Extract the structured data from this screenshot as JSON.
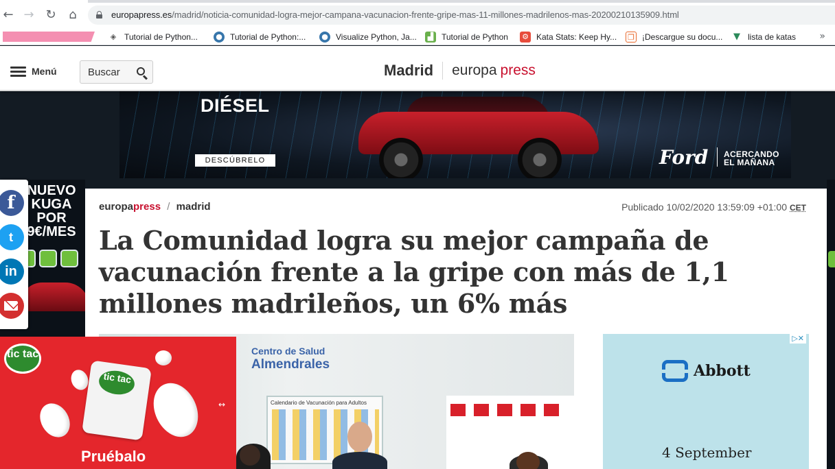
{
  "browser": {
    "nav": {
      "back": "←",
      "forward": "→",
      "reload": "↻",
      "home": "⌂"
    },
    "url": {
      "host": "europapress.es",
      "path": "/madrid/noticia-comunidad-logra-mejor-campana-vacunacion-frente-gripe-mas-11-millones-madrilenos-mas-20200210135909.html"
    },
    "bookmarks": [
      {
        "label": "Tutorial de Python...",
        "icon": "diamond-icon",
        "color": "#555555"
      },
      {
        "label": "Tutorial de Python:...",
        "icon": "python-icon",
        "color": "#3776ab"
      },
      {
        "label": "Visualize Python, Ja...",
        "icon": "python-icon",
        "color": "#3776ab"
      },
      {
        "label": "Tutorial de Python",
        "icon": "chart-icon",
        "color": "#6ab04c"
      },
      {
        "label": "Kata Stats: Keep Hy...",
        "icon": "kata-icon",
        "color": "#e74c3c"
      },
      {
        "label": "¡Descargue su docu...",
        "icon": "doc-icon",
        "color": "#e8672a"
      },
      {
        "label": "lista de katas",
        "icon": "vue-icon",
        "color": "#2c8a5a"
      }
    ],
    "more_bookmarks": "»"
  },
  "site_header": {
    "menu_label": "Menú",
    "search_placeholder": "Buscar",
    "section_name": "Madrid",
    "logo_part1": "europa",
    "logo_part2": "press"
  },
  "top_ad": {
    "headline": "DIÉSEL",
    "cta": "DESCÚBRELO",
    "brand": "Ford",
    "tagline_line1": "ACERCANDO",
    "tagline_line2": "EL MAÑANA"
  },
  "skin_ad": {
    "line1": "NUEVO",
    "line2": "KUGA",
    "line3": "POR",
    "line4": "9€/MES"
  },
  "share": {
    "facebook": "f",
    "twitter": "t",
    "linkedin": "in"
  },
  "article": {
    "breadcrumb_brand1": "europa",
    "breadcrumb_brand2": "press",
    "breadcrumb_sep": "/",
    "breadcrumb_section": "madrid",
    "published": "Publicado 10/02/2020 13:59:09 +01:00",
    "timezone": "CET",
    "headline": "La Comunidad logra su mejor campaña de vacunación frente a la gripe con más de 1,1 millones madrileños, un 6% más",
    "photo": {
      "sign_line1": "Centro de Salud",
      "sign_line2": "Almendrales",
      "board_title": "Calendario de Vacunación para Adultos"
    }
  },
  "sidebar_ad": {
    "adchoices": "▷✕",
    "brand": "Abbott",
    "date": "4 September"
  },
  "float_ad": {
    "logo": "tic tac",
    "pack_label": "tic tac",
    "cta": "Pruébalo",
    "arrows": "↔"
  },
  "colors": {
    "brand_red": "#c8102e",
    "page_bg": "#131b23",
    "tictac_red": "#e4262c"
  }
}
